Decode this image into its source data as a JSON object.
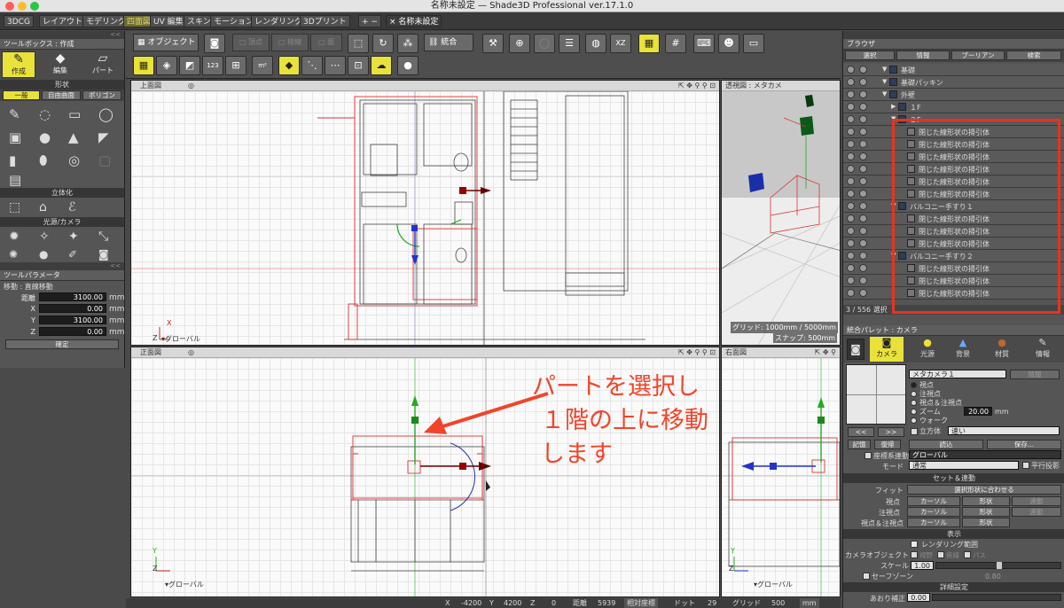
{
  "window": {
    "title": "名称未設定 — Shade3D Professional ver.17.1.0"
  },
  "tabs": [
    {
      "label": "3DCG"
    },
    {
      "label": "レイアウト"
    },
    {
      "label": "モデリング"
    },
    {
      "label": "四面図"
    },
    {
      "label": "UV 編集"
    },
    {
      "label": "スキン"
    },
    {
      "label": "モーション"
    },
    {
      "label": "レンダリング"
    },
    {
      "label": "3Dプリント"
    },
    {
      "label": "+ −"
    },
    {
      "label": "× 名称未設定"
    }
  ],
  "toolbox": {
    "title": "ツールボックス : 作成",
    "modes": [
      "作成",
      "編集",
      "パート"
    ],
    "shape_header": "形状",
    "shape_tabs": [
      "一般",
      "自由曲面",
      "ポリゴン"
    ],
    "solidify_header": "立体化",
    "light_header": "光源/カメラ"
  },
  "tool_params": {
    "title": "ツールパラメータ",
    "mode": "移動 : 直線移動",
    "fields": [
      {
        "label": "距離",
        "value": "3100.00",
        "unit": "mm"
      },
      {
        "label": "X",
        "value": "0.00",
        "unit": "mm"
      },
      {
        "label": "Y",
        "value": "3100.00",
        "unit": "mm"
      },
      {
        "label": "Z",
        "value": "0.00",
        "unit": "mm"
      }
    ],
    "confirm": "確定"
  },
  "main_toolbar": {
    "object_button": "オブジェクト",
    "vertex": "頂点",
    "edge": "稜線",
    "face": "面",
    "merge": "統合"
  },
  "viewports": {
    "top": {
      "title": "上面図",
      "axis_x": "X",
      "axis_z": "Z",
      "coord": "グローバル"
    },
    "persp": {
      "title": "透視図 : メタカメ",
      "grid": "グリッド: 1000mm / 5000mm",
      "snap": "スナップ: 500mm"
    },
    "front": {
      "title": "正面図",
      "axis_y": "Y",
      "axis_z": "Z",
      "coord": "グローバル"
    },
    "right": {
      "title": "右面図",
      "axis_y": "Y",
      "axis_z": "Z",
      "coord": "グローバル"
    }
  },
  "annotation": {
    "line1": "パートを選択し",
    "line2": "１階の上に移動します",
    "color": "#f2442a"
  },
  "statusbar": {
    "x_label": "X",
    "x": "-4200",
    "y_label": "Y",
    "y": "4200",
    "z_label": "Z",
    "z": "0",
    "dist_label": "距離",
    "dist": "5939",
    "rel": "相対座標",
    "dot_label": "ドット",
    "dot": "29",
    "grid_label": "グリッド",
    "grid": "500",
    "unit": "mm"
  },
  "browser": {
    "title": "ブラウザ",
    "tabs": [
      "選択",
      "情報",
      "ブーリアン",
      "検索"
    ],
    "items": [
      {
        "label": "基礎",
        "type": "part",
        "indent": 1
      },
      {
        "label": "基礎パッキン",
        "type": "part",
        "indent": 1
      },
      {
        "label": "外壁",
        "type": "part",
        "indent": 1
      },
      {
        "label": "１F",
        "type": "part",
        "indent": 2
      },
      {
        "label": "２F",
        "type": "part",
        "indent": 2
      },
      {
        "label": "閉じた線形状の掃引体",
        "type": "obj",
        "indent": 3
      },
      {
        "label": "閉じた線形状の掃引体",
        "type": "obj",
        "indent": 3
      },
      {
        "label": "閉じた線形状の掃引体",
        "type": "obj",
        "indent": 3
      },
      {
        "label": "閉じた線形状の掃引体",
        "type": "obj",
        "indent": 3
      },
      {
        "label": "閉じた線形状の掃引体",
        "type": "obj",
        "indent": 3
      },
      {
        "label": "閉じた線形状の掃引体",
        "type": "obj",
        "indent": 3
      },
      {
        "label": "バルコニー手すり１",
        "type": "part",
        "indent": 2
      },
      {
        "label": "閉じた線形状の掃引体",
        "type": "obj",
        "indent": 3
      },
      {
        "label": "閉じた線形状の掃引体",
        "type": "obj",
        "indent": 3
      },
      {
        "label": "閉じた線形状の掃引体",
        "type": "obj",
        "indent": 3
      },
      {
        "label": "バルコニー手すり２",
        "type": "part",
        "indent": 2
      },
      {
        "label": "閉じた線形状の掃引体",
        "type": "obj",
        "indent": 3
      },
      {
        "label": "閉じた線形状の掃引体",
        "type": "obj",
        "indent": 3
      },
      {
        "label": "閉じた線形状の掃引体",
        "type": "obj",
        "indent": 3
      }
    ],
    "count": "3 / 556 選択"
  },
  "palette": {
    "title": "統合パレット : カメラ",
    "tabs": [
      "カメラ",
      "光源",
      "背景",
      "材質",
      "情報"
    ],
    "camera_name": "メタカメラ１",
    "info_btn": "情報",
    "radios": [
      "視点",
      "注視点",
      "視点＆注視点",
      "ズーム",
      "ウォーク"
    ],
    "zoom_value": "20.00",
    "zoom_unit": "mm",
    "cube_label": "立方体",
    "cube_value": "速い",
    "nav_prev": "<<",
    "nav_next": ">>",
    "memo": "記憶",
    "restore": "復帰",
    "load": "読込",
    "save": "保存...",
    "coord_label": "座標系連動",
    "coord_value": "グローバル",
    "mode_label": "モード",
    "mode_value": "通常",
    "parallel": "平行投影",
    "set_header": "セット＆連動",
    "fit_label": "フィット",
    "fit_value": "選択形状に合わせる",
    "view_label": "視点",
    "target_label": "注視点",
    "both_label": "視点＆注視点",
    "cursor": "カーソル",
    "shape": "形状",
    "link": "連動",
    "display_header": "表示",
    "render_range": "レンダリング範囲",
    "cam_obj_label": "カメラオブジェクト",
    "cam_opts": [
      "視野",
      "焦線",
      "パス"
    ],
    "scale_label": "スケール",
    "scale_value": "1.00",
    "safe_zone": "セーフゾーン",
    "safe_value": "0.80",
    "detail_header": "詳細設定",
    "tilt_label": "あおり補正",
    "tilt_value": "0.00"
  },
  "colors": {
    "selection": "#e8331f",
    "accent_yellow": "#e8e23a"
  }
}
